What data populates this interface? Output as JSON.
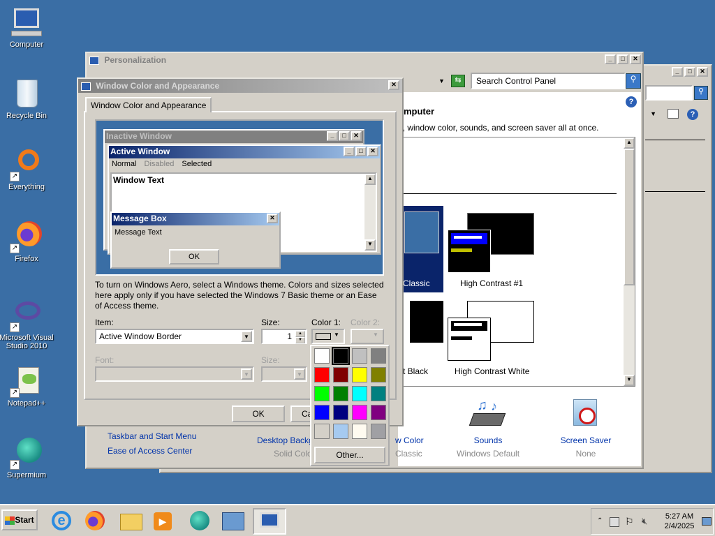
{
  "desktop": {
    "icons": [
      {
        "label": "Computer",
        "icon": "computer-icon"
      },
      {
        "label": "Recycle Bin",
        "icon": "recycle-bin-icon"
      },
      {
        "label": "Everything",
        "icon": "everything-icon"
      },
      {
        "label": "Firefox",
        "icon": "firefox-icon"
      },
      {
        "label": "Microsoft Visual Studio 2010",
        "icon": "visual-studio-icon"
      },
      {
        "label": "Notepad++",
        "icon": "notepadpp-icon"
      },
      {
        "label": "Supermium",
        "icon": "supermium-icon"
      }
    ]
  },
  "personalization": {
    "title": "Personalization",
    "search_placeholder": "Search Control Panel",
    "heading": "omputer",
    "subheading": "d, window color, sounds, and screen saver all at once.",
    "themes": [
      {
        "label": "Classic"
      },
      {
        "label": "High Contrast #1"
      },
      {
        "label": "st Black"
      },
      {
        "label": "High Contrast White"
      }
    ],
    "see_also": [
      "Taskbar and Start Menu",
      "Ease of Access Center"
    ],
    "bottom_items": [
      {
        "label": "Desktop Backgro",
        "sub": "Solid Color"
      },
      {
        "label": "w Color",
        "sub": "Classic"
      },
      {
        "label": "Sounds",
        "sub": "Windows Default"
      },
      {
        "label": "Screen Saver",
        "sub": "None"
      }
    ]
  },
  "dialog": {
    "title": "Window Color and Appearance",
    "tab": "Window Color and Appearance",
    "preview": {
      "inactive_title": "Inactive Window",
      "active_title": "Active Window",
      "menu": [
        "Normal",
        "Disabled",
        "Selected"
      ],
      "window_text": "Window Text",
      "msgbox_title": "Message Box",
      "msgbox_text": "Message Text",
      "ok": "OK"
    },
    "info": "To turn on Windows Aero, select a Windows theme.  Colors and sizes selected here apply only if you have selected the Windows 7 Basic theme or an Ease of Access theme.",
    "item_label": "Item:",
    "item_value": "Active Window Border",
    "size_label": "Size:",
    "size_value": "1",
    "color1_label": "Color 1:",
    "color2_label": "Color 2:",
    "font_label": "Font:",
    "font_size_label": "Size:",
    "ok": "OK",
    "cancel": "Ca",
    "palette": {
      "colors": [
        "#ffffff",
        "#000000",
        "#c0c0c0",
        "#808080",
        "#ff0000",
        "#800000",
        "#ffff00",
        "#808000",
        "#00ff00",
        "#008000",
        "#00ffff",
        "#008080",
        "#0000ff",
        "#000080",
        "#ff00ff",
        "#800080",
        "#d4d0c8",
        "#a6caf0",
        "#fffbf0",
        "#a0a0a4"
      ],
      "other": "Other..."
    }
  },
  "taskbar": {
    "start": "Start",
    "time": "5:27 AM",
    "date": "2/4/2025"
  }
}
